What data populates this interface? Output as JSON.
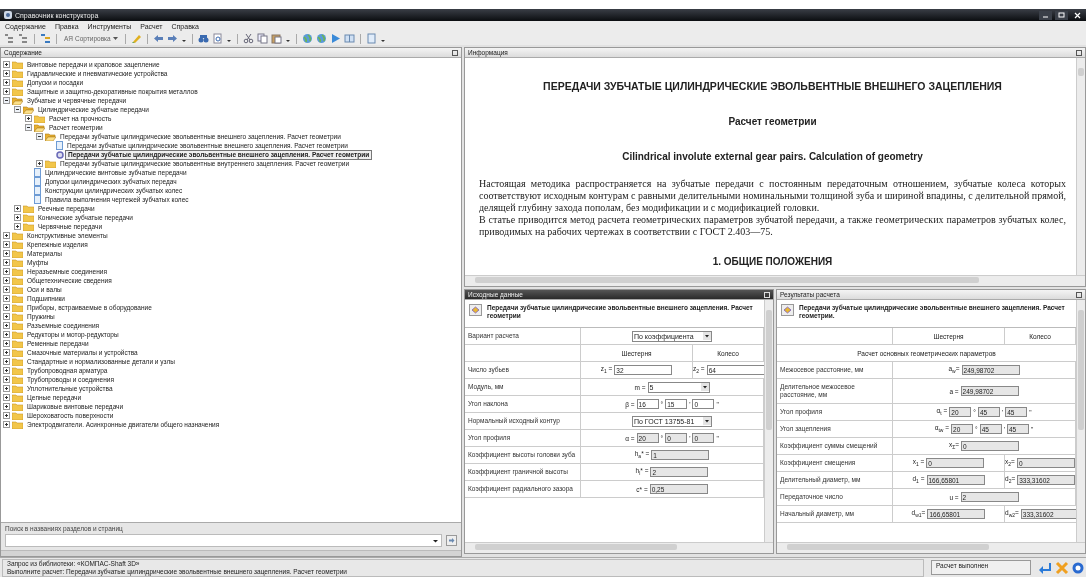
{
  "window": {
    "title": "Справочник конструктора"
  },
  "menu": [
    "Содержание",
    "Правка",
    "Инструменты",
    "Расчет",
    "Справка"
  ],
  "toolbar": {
    "sort_icon_text": "АЯ",
    "sort_label": "Сортировка"
  },
  "contents_panel": {
    "title": "Содержание",
    "active": false,
    "tree": [
      {
        "label": "Винтовые передачи и краповое зацепление",
        "kind": "folder",
        "expanded": false,
        "selected": false
      },
      {
        "label": "Гидравлические и пневматические устройства",
        "kind": "folder",
        "expanded": false,
        "selected": false
      },
      {
        "label": "Допуски и посадки",
        "kind": "folder",
        "expanded": false,
        "selected": false
      },
      {
        "label": "Защитные и защитно-декоративные покрытия металлов",
        "kind": "folder",
        "expanded": false,
        "selected": false
      },
      {
        "label": "Зубчатые и червячные передачи",
        "kind": "folder",
        "expanded": true,
        "selected": false,
        "children": [
          {
            "label": "Цилиндрические зубчатые передачи",
            "kind": "folder",
            "expanded": true,
            "selected": false,
            "children": [
              {
                "label": "Расчет на прочность",
                "kind": "folder",
                "expanded": false,
                "selected": false
              },
              {
                "label": "Расчет геометрии",
                "kind": "folder",
                "expanded": true,
                "selected": false,
                "children": [
                  {
                    "label": "Передачи зубчатые цилиндрические эвольвентные внешнего зацепления. Расчет геометрии",
                    "kind": "folder",
                    "expanded": true,
                    "selected": false,
                    "children": [
                      {
                        "label": "Передачи зубчатые цилиндрические эвольвентные внешнего зацепления. Расчет геометрии",
                        "kind": "page",
                        "selected": false
                      },
                      {
                        "label": "Передачи зубчатые цилиндрические эвольвентные внешнего зацепления. Расчет геометрии",
                        "kind": "calc",
                        "selected": true
                      }
                    ]
                  },
                  {
                    "label": "Передачи зубчатые цилиндрические эвольвентные внутреннего зацепления. Расчет геометрии",
                    "kind": "folder",
                    "expanded": false,
                    "selected": false
                  }
                ]
              },
              {
                "label": "Цилиндрические винтовые зубчатые передачи",
                "kind": "page",
                "selected": false
              },
              {
                "label": "Допуски цилиндрических зубчатых передач",
                "kind": "page",
                "selected": false
              },
              {
                "label": "Конструкции цилиндрических зубчатых колес",
                "kind": "page",
                "selected": false
              },
              {
                "label": "Правила выполнения чертежей зубчатых колес",
                "kind": "page",
                "selected": false
              }
            ]
          },
          {
            "label": "Реечные передачи",
            "kind": "folder",
            "expanded": false,
            "selected": false
          },
          {
            "label": "Конические зубчатые передачи",
            "kind": "folder",
            "expanded": false,
            "selected": false
          },
          {
            "label": "Червячные передачи",
            "kind": "folder",
            "expanded": false,
            "selected": false
          }
        ]
      },
      {
        "label": "Конструктивные элементы",
        "kind": "folder",
        "expanded": false,
        "selected": false
      },
      {
        "label": "Крепежные изделия",
        "kind": "folder",
        "expanded": false,
        "selected": false
      },
      {
        "label": "Материалы",
        "kind": "folder",
        "expanded": false,
        "selected": false
      },
      {
        "label": "Муфты",
        "kind": "folder",
        "expanded": false,
        "selected": false
      },
      {
        "label": "Неразъемные соединения",
        "kind": "folder",
        "expanded": false,
        "selected": false
      },
      {
        "label": "Общетехнические сведения",
        "kind": "folder",
        "expanded": false,
        "selected": false
      },
      {
        "label": "Оси и валы",
        "kind": "folder",
        "expanded": false,
        "selected": false
      },
      {
        "label": "Подшипники",
        "kind": "folder",
        "expanded": false,
        "selected": false
      },
      {
        "label": "Приборы, встраиваемые в оборудование",
        "kind": "folder",
        "expanded": false,
        "selected": false
      },
      {
        "label": "Пружины",
        "kind": "folder",
        "expanded": false,
        "selected": false
      },
      {
        "label": "Разъемные соединения",
        "kind": "folder",
        "expanded": false,
        "selected": false
      },
      {
        "label": "Редукторы и мотор-редукторы",
        "kind": "folder",
        "expanded": false,
        "selected": false
      },
      {
        "label": "Ременные передачи",
        "kind": "folder",
        "expanded": false,
        "selected": false
      },
      {
        "label": "Смазочные материалы и устройства",
        "kind": "folder",
        "expanded": false,
        "selected": false
      },
      {
        "label": "Стандартные и нормализованные детали и узлы",
        "kind": "folder",
        "expanded": false,
        "selected": false
      },
      {
        "label": "Трубопроводная арматура",
        "kind": "folder",
        "expanded": false,
        "selected": false
      },
      {
        "label": "Трубопроводы и соединения",
        "kind": "folder",
        "expanded": false,
        "selected": false
      },
      {
        "label": "Уплотнительные устройства",
        "kind": "folder",
        "expanded": false,
        "selected": false
      },
      {
        "label": "Цепные передачи",
        "kind": "folder",
        "expanded": false,
        "selected": false
      },
      {
        "label": "Шариковые винтовые передачи",
        "kind": "folder",
        "expanded": false,
        "selected": false
      },
      {
        "label": "Шероховатость поверхности",
        "kind": "folder",
        "expanded": false,
        "selected": false
      },
      {
        "label": "Электродвигатели. Асинхронные двигатели общего назначения",
        "kind": "folder",
        "expanded": false,
        "selected": false
      }
    ],
    "search": {
      "label": "Поиск в названиях разделов и страниц"
    }
  },
  "info_panel": {
    "title": "Информация",
    "active": false,
    "heading": "ПЕРЕДАЧИ ЗУБЧАТЫЕ ЦИЛИНДРИЧЕСКИЕ ЭВОЛЬВЕНТНЫЕ ВНЕШНЕГО ЗАЦЕПЛЕНИЯ",
    "subheading": "Расчет геометрии",
    "english_heading": "Cilindrical involute external gear pairs. Calculation of geometry",
    "paragraphs": [
      "Настоящая методика распространяется на зубчатые передачи с постоянным передаточным отношением, зубчатые колеса которых соответствуют исходным контурам с равными делительными номинальными толщиной зуба и шириной впадины, с делительной прямой, делящей глубину захода пополам, без модификации и с модификацией головки.",
      "В статье приводится метод расчета геометрических параметров зубчатой передачи, а также геометрических параметров зубчатых колес, приводимых на рабочих чертежах в соответствии с ГОСТ 2.403—75."
    ],
    "section_heading": "1. ОБЩИЕ ПОЛОЖЕНИЯ"
  },
  "input_panel": {
    "title": "Исходные данные",
    "active": true,
    "caption": "Передачи зубчатые цилиндрические эвольвентные внешнего зацепления. Расчет геометрии",
    "rows": [
      {
        "kind": "span",
        "label": "Вариант расчета",
        "cells": [
          {
            "kind": "combo",
            "value": "По коэффициента"
          }
        ]
      },
      {
        "kind": "header",
        "columns": [
          "Шестерня",
          "Колесо"
        ]
      },
      {
        "kind": "pair",
        "label": "Число зубьев",
        "cells": [
          {
            "kind": "fields",
            "symbol": "z$_{1}$ =",
            "readonly": false,
            "inputs": [
              {
                "value": "32"
              }
            ]
          },
          {
            "kind": "fields",
            "symbol": "z$_{2}$ =",
            "readonly": false,
            "inputs": [
              {
                "value": "64"
              }
            ]
          }
        ]
      },
      {
        "kind": "span",
        "label": "Модуль, мм",
        "cells": [
          {
            "kind": "combo",
            "symbol": "m =",
            "value": "5"
          }
        ]
      },
      {
        "kind": "span",
        "label": "Угол наклона",
        "cells": [
          {
            "kind": "fields",
            "symbol": "β =",
            "readonly": false,
            "inputs": [
              {
                "value": "16",
                "unit": "°"
              },
              {
                "value": "15",
                "unit": "'"
              },
              {
                "value": "0",
                "unit": "\""
              }
            ]
          }
        ]
      },
      {
        "kind": "span",
        "label": "Нормальный исходный контур",
        "cells": [
          {
            "kind": "combo",
            "value": "По ГОСТ 13755-81"
          }
        ]
      },
      {
        "kind": "span",
        "label": "Угол профиля",
        "cells": [
          {
            "kind": "fields",
            "symbol": "α =",
            "readonly": true,
            "inputs": [
              {
                "value": "20",
                "unit": "°"
              },
              {
                "value": "0",
                "unit": "'"
              },
              {
                "value": "0",
                "unit": "\""
              }
            ]
          }
        ]
      },
      {
        "kind": "span",
        "label": "Коэффициент высоты головки зуба",
        "cells": [
          {
            "kind": "fields",
            "symbol": "h$_{a}$* =",
            "readonly": true,
            "inputs": [
              {
                "value": "1"
              }
            ]
          }
        ]
      },
      {
        "kind": "span",
        "label": "Коэффициент граничной высоты",
        "cells": [
          {
            "kind": "fields",
            "symbol": "h$_{l}$* =",
            "readonly": true,
            "inputs": [
              {
                "value": "2"
              }
            ]
          }
        ]
      },
      {
        "kind": "span",
        "label": "Коэффициент радиального зазора",
        "cells": [
          {
            "kind": "fields",
            "symbol": "c* =",
            "readonly": true,
            "inputs": [
              {
                "value": "0,25"
              }
            ]
          }
        ]
      }
    ]
  },
  "results_panel": {
    "title": "Результаты расчета",
    "active": false,
    "caption": "Передачи зубчатые цилиндрические эвольвентные внешнего зацепления. Расчет геометрии.",
    "rows": [
      {
        "kind": "header",
        "columns": [
          "Шестерня",
          "Колесо"
        ]
      },
      {
        "kind": "section",
        "label": "Расчет основных геометрических параметров"
      },
      {
        "kind": "span",
        "label": "Межосевое расстояние, мм",
        "cells": [
          {
            "kind": "fields",
            "symbol": "a$_{w}$=",
            "readonly": true,
            "inputs": [
              {
                "value": "249,98702"
              }
            ]
          }
        ]
      },
      {
        "kind": "span",
        "label": "Делительное межосевое расстояние, мм",
        "cells": [
          {
            "kind": "fields",
            "symbol": "a =",
            "readonly": true,
            "inputs": [
              {
                "value": "249,98702"
              }
            ]
          }
        ]
      },
      {
        "kind": "span",
        "label": "Угол профиля",
        "cells": [
          {
            "kind": "fields",
            "symbol": "α$_{t}$ =",
            "readonly": true,
            "inputs": [
              {
                "value": "20",
                "unit": "°"
              },
              {
                "value": "45",
                "unit": "'"
              },
              {
                "value": "45",
                "unit": "\""
              }
            ]
          }
        ]
      },
      {
        "kind": "span",
        "label": "Угол зацепления",
        "cells": [
          {
            "kind": "fields",
            "symbol": "α$_{tw}$ =",
            "readonly": true,
            "inputs": [
              {
                "value": "20",
                "unit": "°"
              },
              {
                "value": "45",
                "unit": "'"
              },
              {
                "value": "45",
                "unit": "\""
              }
            ]
          }
        ]
      },
      {
        "kind": "span",
        "label": "Коэффициент суммы смещений",
        "cells": [
          {
            "kind": "fields",
            "symbol": "x$_{Σ}$=",
            "readonly": true,
            "inputs": [
              {
                "value": "0"
              }
            ]
          }
        ]
      },
      {
        "kind": "pair",
        "label": "Коэффициент смещения",
        "cells": [
          {
            "kind": "fields",
            "symbol": "x$_{1}$ =",
            "readonly": true,
            "inputs": [
              {
                "value": "0"
              }
            ]
          },
          {
            "kind": "fields",
            "symbol": "x$_{2}$=",
            "readonly": true,
            "inputs": [
              {
                "value": "0"
              }
            ]
          }
        ]
      },
      {
        "kind": "pair",
        "label": "Делительный диаметр, мм",
        "cells": [
          {
            "kind": "fields",
            "symbol": "d$_{1}$ =",
            "readonly": true,
            "inputs": [
              {
                "value": "166,65801"
              }
            ]
          },
          {
            "kind": "fields",
            "symbol": "d$_{2}$=",
            "readonly": true,
            "inputs": [
              {
                "value": "333,31602"
              }
            ]
          }
        ]
      },
      {
        "kind": "span",
        "label": "Передаточное число",
        "cells": [
          {
            "kind": "fields",
            "symbol": "u =",
            "readonly": true,
            "inputs": [
              {
                "value": "2"
              }
            ]
          }
        ]
      },
      {
        "kind": "pair",
        "label": "Начальный диаметр, мм",
        "cells": [
          {
            "kind": "fields",
            "symbol": "d$_{w1}$=",
            "readonly": true,
            "inputs": [
              {
                "value": "166,65801"
              }
            ]
          },
          {
            "kind": "fields",
            "symbol": "d$_{w2}$=",
            "readonly": true,
            "inputs": [
              {
                "value": "333,31602"
              }
            ]
          }
        ]
      }
    ]
  },
  "status_bar": {
    "lines": [
      "Запрос из библиотеки: «КОМПАС-Shaft 3D»",
      "Выполните расчет: Передачи зубчатые цилиндрические эвольвентные внешнего зацепления. Расчет геометрии"
    ],
    "state": "Расчет выполнен"
  }
}
